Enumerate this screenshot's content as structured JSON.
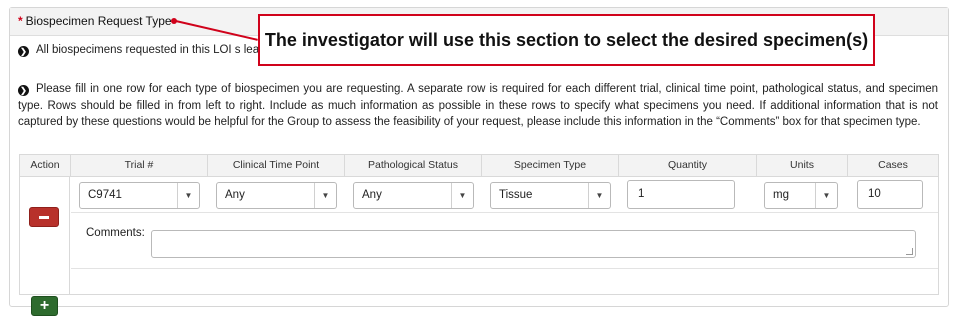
{
  "section": {
    "required_marker": "*",
    "title": "Biospecimen Request Type"
  },
  "callout": {
    "text": "The investigator will use this section to select the desired specimen(s)"
  },
  "instructions": [
    {
      "bullet_icon": "chevron-right-circle-icon",
      "text": "All biospecimens requested in this LOI s                                                                                                                                         lease re-run your query to include all needed specimens and use that query to create a new LOI."
    },
    {
      "bullet_icon": "chevron-right-circle-icon",
      "text": "Please fill in one row for each type of biospecimen you are requesting. A separate row is required for each different trial, clinical time point, pathological status, and specimen type. Rows should be filled in from left to right. Include as much information as possible in these rows to specify what specimens you need. If additional information that is not captured by these questions would be helpful for the Group to assess the feasibility of your request, please include this information in the “Comments” box for that specimen type."
    }
  ],
  "table": {
    "headers": {
      "action": "Action",
      "trial": "Trial #",
      "clinical_time_point": "Clinical Time Point",
      "pathological_status": "Pathological Status",
      "specimen_type": "Specimen Type",
      "quantity": "Quantity",
      "units": "Units",
      "cases": "Cases"
    },
    "row": {
      "trial": "C9741",
      "clinical_time_point": "Any",
      "pathological_status": "Any",
      "specimen_type": "Tissue",
      "quantity": "1",
      "units": "mg",
      "cases": "10",
      "comments_label": "Comments:",
      "comments_value": ""
    },
    "remove_button": "minus-icon",
    "add_button": "+"
  },
  "colors": {
    "required": "#d0021b",
    "callout_border": "#d0021b",
    "remove_button": "#b8312b",
    "add_button": "#2e6b2e"
  }
}
